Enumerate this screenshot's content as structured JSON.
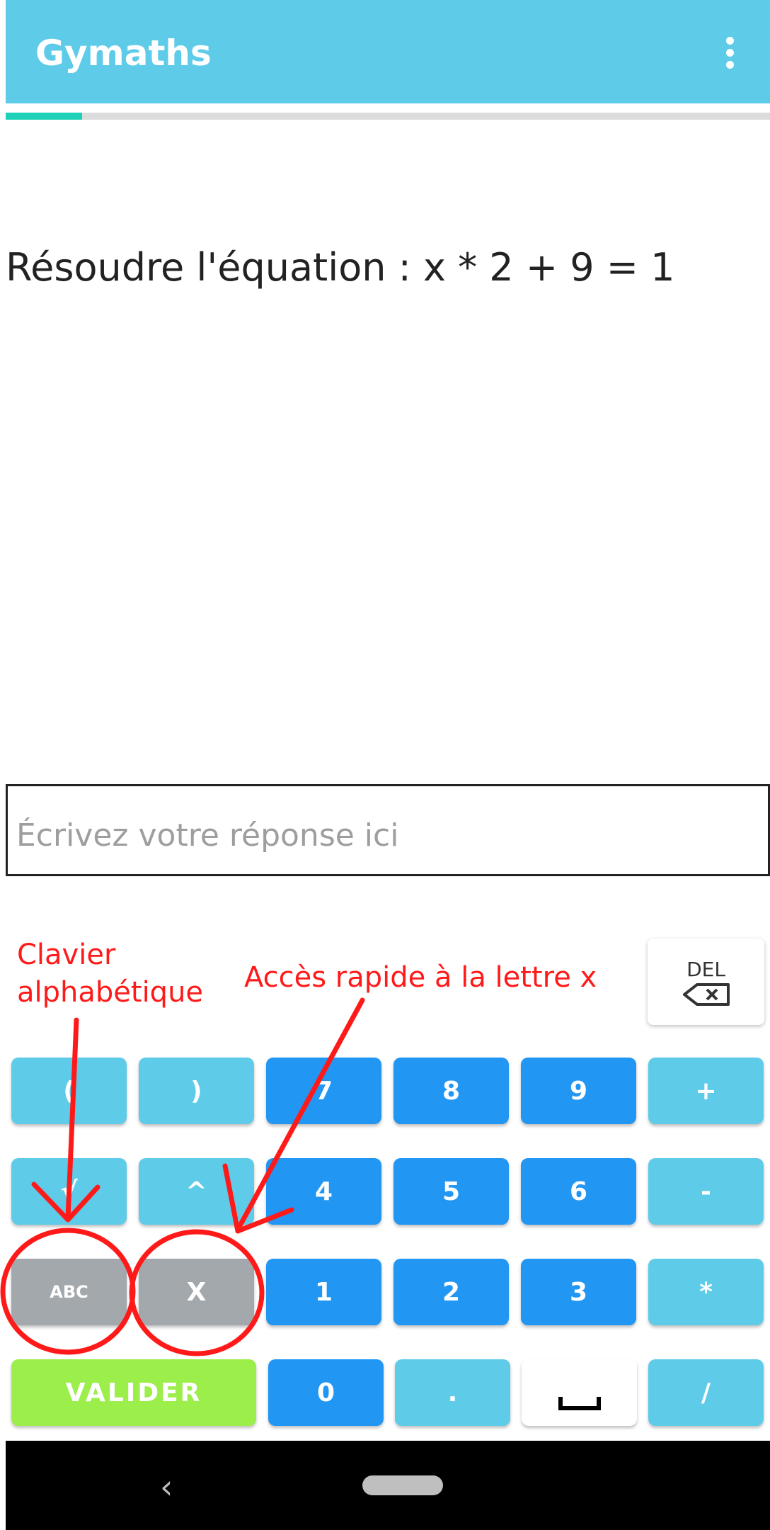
{
  "app": {
    "title": "Gymaths",
    "menu_icon": "more-vert-icon"
  },
  "progress": {
    "fraction": 0.1
  },
  "question": {
    "text": "Résoudre l'équation : x * 2 + 9 = 1"
  },
  "answer": {
    "placeholder": "Écrivez votre réponse ici",
    "value": ""
  },
  "keypad": {
    "del_label": "DEL",
    "del_icon": "backspace-icon",
    "row1": [
      "(",
      ")",
      "7",
      "8",
      "9",
      "+"
    ],
    "row2": [
      "√",
      "^",
      "4",
      "5",
      "6",
      "-"
    ],
    "row3": [
      "ABC",
      "X",
      "1",
      "2",
      "3",
      "*"
    ],
    "row4": [
      "VALIDER",
      "0",
      ".",
      "␣",
      "/"
    ],
    "colors": {
      "light": "#5ecbe8",
      "blue": "#2196f3",
      "gray": "#a3a8ad",
      "green": "#9cee4b"
    }
  },
  "annotations": {
    "left_line1": "Clavier",
    "left_line2": "alphabétique",
    "right": "Accès rapide à la lettre x",
    "color": "#ff1a1a"
  },
  "navbar": {
    "back_icon": "back-chevron-icon",
    "home_icon": "home-pill-icon"
  }
}
